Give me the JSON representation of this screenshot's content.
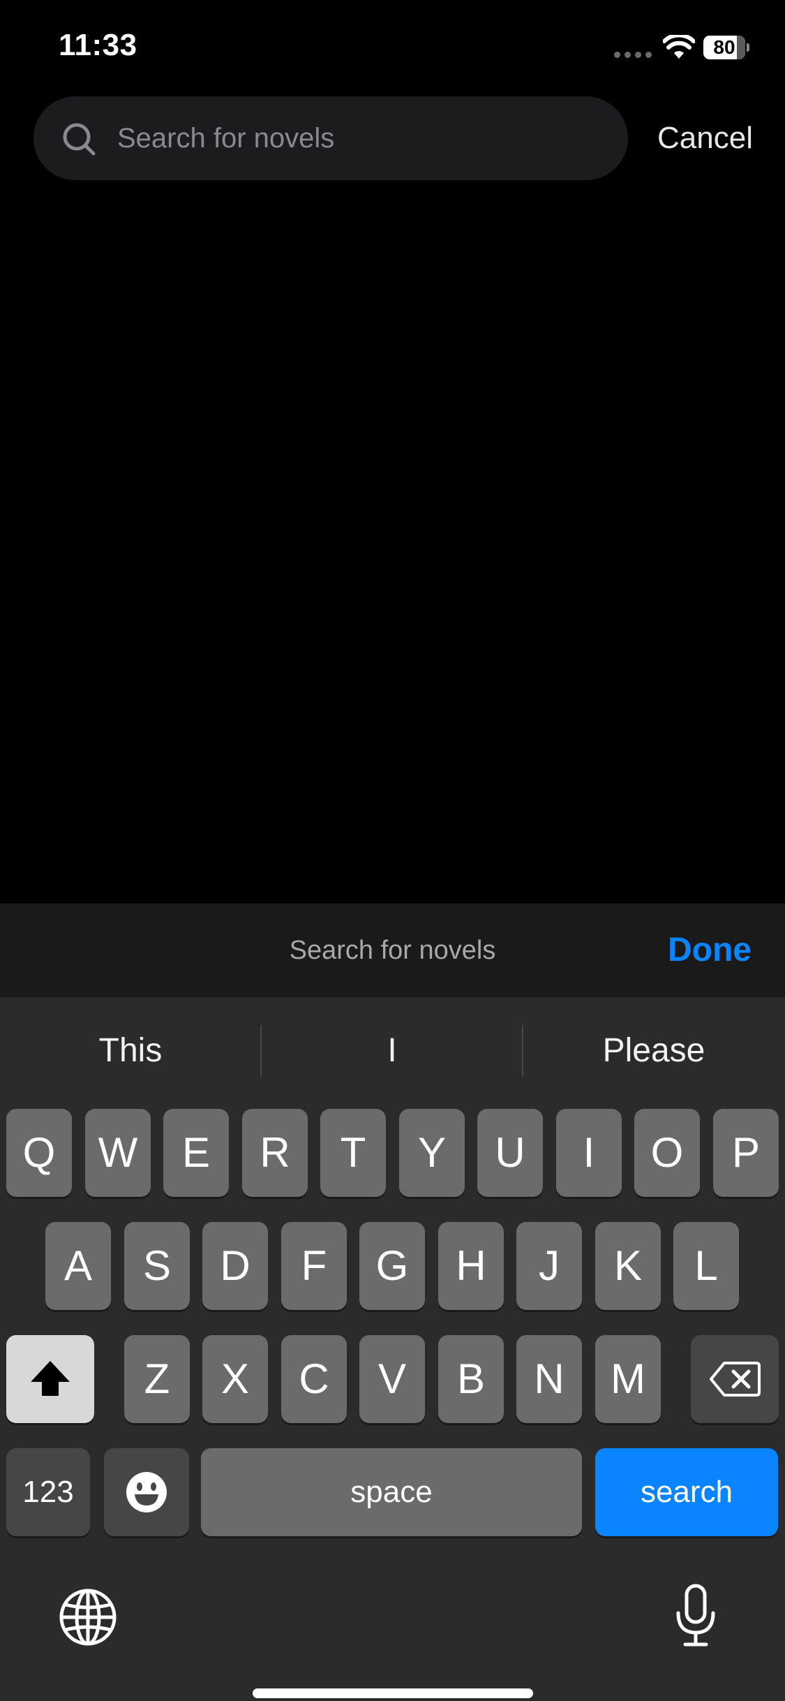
{
  "status_bar": {
    "time": "11:33",
    "battery_percent": "80",
    "battery_level": 0.8
  },
  "search": {
    "placeholder": "Search for novels",
    "cancel_label": "Cancel"
  },
  "accessory_bar": {
    "title": "Search for novels",
    "done_label": "Done"
  },
  "keyboard": {
    "suggestions": [
      "This",
      "I",
      "Please"
    ],
    "row1": [
      "Q",
      "W",
      "E",
      "R",
      "T",
      "Y",
      "U",
      "I",
      "O",
      "P"
    ],
    "row2": [
      "A",
      "S",
      "D",
      "F",
      "G",
      "H",
      "J",
      "K",
      "L"
    ],
    "row3": [
      "Z",
      "X",
      "C",
      "V",
      "B",
      "N",
      "M"
    ],
    "numbers_label": "123",
    "space_label": "space",
    "search_label": "search",
    "icons": {
      "shift": "shift-icon",
      "backspace": "backspace-icon",
      "emoji": "emoji-icon",
      "globe": "globe-icon",
      "mic": "microphone-icon"
    }
  },
  "colors": {
    "accent": "#0a84ff",
    "background": "#000000",
    "keyboard_bg": "#2b2b2b",
    "key_bg": "#6b6b6b"
  }
}
